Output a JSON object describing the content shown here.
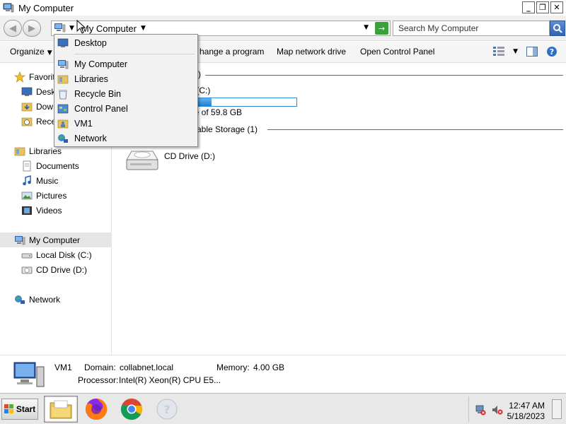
{
  "window": {
    "title": "My Computer",
    "minimize": "_",
    "maximize": "❐",
    "close": "✕"
  },
  "address": {
    "breadcrumb": "My Computer",
    "go_glyph": "→",
    "search_placeholder": "Search My Computer"
  },
  "toolbar": {
    "organize": "Organize",
    "change_program": "hange a program",
    "map_network_drive": "Map network drive",
    "open_control_panel": "Open Control Panel"
  },
  "address_dropdown": {
    "items": [
      "Desktop",
      "My Computer",
      "Libraries",
      "Recycle Bin",
      "Control Panel",
      "VM1",
      "Network"
    ]
  },
  "nav": {
    "favorites": [
      "Favorit",
      "Desk",
      "Dow",
      "Rece"
    ],
    "libraries": "Libraries",
    "library_items": [
      "Documents",
      "Music",
      "Pictures",
      "Videos"
    ],
    "my_computer": "My Computer",
    "drives": [
      "Local Disk (C:)",
      "CD Drive (D:)"
    ],
    "network": "Network"
  },
  "content": {
    "hdd_group_suffix": ")",
    "local_disk_label": "k (C:)",
    "local_disk_used_fraction": 0.24,
    "local_disk_free": "ee of 59.8 GB",
    "removable_group": "vable Storage (1)",
    "cd_drive_label": "CD Drive (D:)"
  },
  "details": {
    "name": "VM1",
    "domain_label": "Domain:",
    "domain": "collabnet.local",
    "memory_label": "Memory:",
    "memory": "4.00 GB",
    "processor_label": "Processor:",
    "processor": "Intel(R) Xeon(R) CPU E5..."
  },
  "taskbar": {
    "start": "Start",
    "time": "12:47 AM",
    "date": "5/18/2023"
  }
}
